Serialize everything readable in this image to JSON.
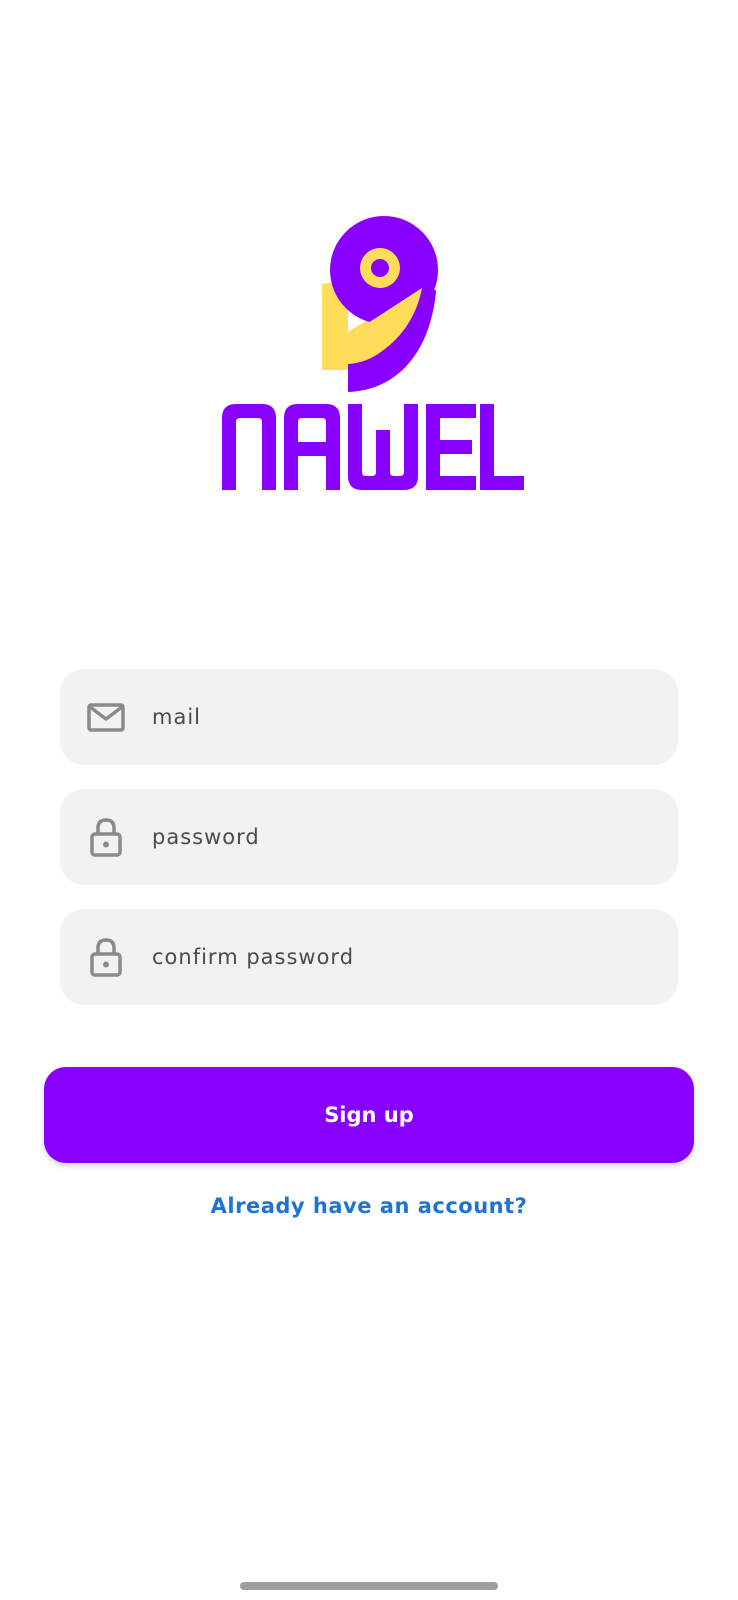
{
  "brand": {
    "name": "NAWEL",
    "primary_color": "#8800ff",
    "accent_color": "#ffdc5a"
  },
  "form": {
    "fields": [
      {
        "id": "mail",
        "icon": "mail-icon",
        "placeholder": "mail",
        "value": ""
      },
      {
        "id": "password",
        "icon": "lock-icon",
        "placeholder": "password",
        "value": ""
      },
      {
        "id": "confirm_password",
        "icon": "lock-icon",
        "placeholder": "confirm password",
        "value": ""
      }
    ],
    "submit_label": "Sign up",
    "login_link_label": "Already have an account?"
  },
  "colors": {
    "field_background": "#f2f2f2",
    "link": "#1e73d8",
    "icon": "#8a8a8a"
  }
}
